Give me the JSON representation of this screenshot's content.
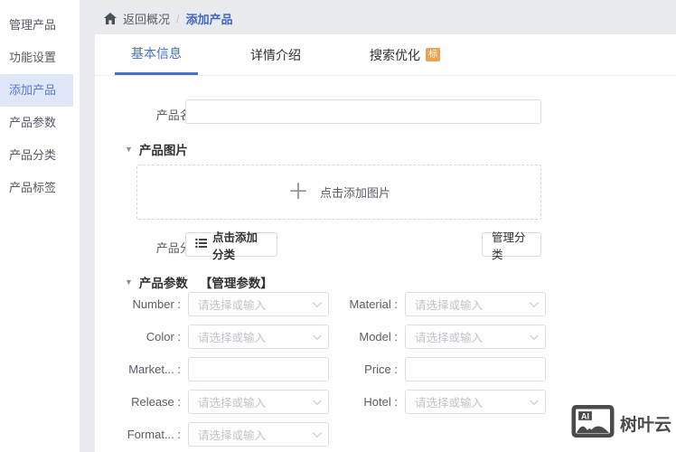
{
  "sidebar": {
    "items": [
      {
        "label": "管理产品",
        "active": false
      },
      {
        "label": "功能设置",
        "active": false
      },
      {
        "label": "添加产品",
        "active": true
      },
      {
        "label": "产品参数",
        "active": false
      },
      {
        "label": "产品分类",
        "active": false
      },
      {
        "label": "产品标签",
        "active": false
      }
    ]
  },
  "breadcrumb": {
    "back": "返回概况",
    "separator": "/",
    "current": "添加产品"
  },
  "tabs": {
    "basic": "基本信息",
    "detail": "详情介绍",
    "seo": "搜索优化",
    "seo_badge": "标"
  },
  "form": {
    "name_label": "产品名称 :",
    "image_section": {
      "title": "产品图片",
      "collapse_icon": "▼",
      "plus": "＋",
      "upload_text": "点击添加图片"
    },
    "category": {
      "label": "产品分类 :",
      "add_button": "点击添加分类",
      "manage_button": "管理分类"
    },
    "params_section": {
      "title": "产品参数",
      "collapse_icon": "▼",
      "manage_link": "【管理参数】"
    },
    "param_fields": [
      {
        "label": "Number :",
        "type": "select",
        "placeholder": "请选择或输入"
      },
      {
        "label": "Material :",
        "type": "select",
        "placeholder": "请选择或输入"
      },
      {
        "label": "Color :",
        "type": "select",
        "placeholder": "请选择或输入"
      },
      {
        "label": "Model :",
        "type": "select",
        "placeholder": "请选择或输入"
      },
      {
        "label": "Market... :",
        "type": "input",
        "placeholder": ""
      },
      {
        "label": "Price :",
        "type": "input",
        "placeholder": ""
      },
      {
        "label": "Release :",
        "type": "select",
        "placeholder": "请选择或输入"
      },
      {
        "label": "Hotel :",
        "type": "select",
        "placeholder": "请选择或输入"
      },
      {
        "label": "Format... :",
        "type": "select",
        "placeholder": "请选择或输入"
      }
    ]
  },
  "watermark": {
    "logo_text": "AI",
    "brand": "树叶云"
  },
  "colors": {
    "accent_blue": "#4a6fc4",
    "active_sidebar_bg": "#dfe6f7",
    "badge_orange": "#f0a14e",
    "page_bg": "#e9eaee",
    "border": "#dcdfe6",
    "placeholder": "#c0c4cc",
    "watermark_gray": "#4b4b4b"
  }
}
